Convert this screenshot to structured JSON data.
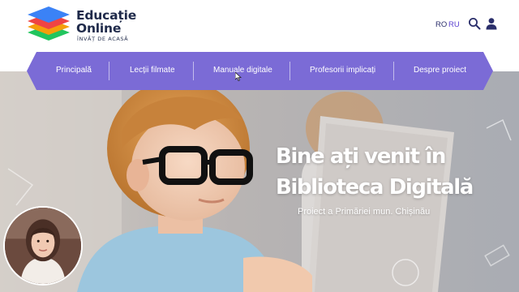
{
  "header": {
    "logo_title_line1": "Educație",
    "logo_title_line2": "Online",
    "logo_tagline": "ÎNVĂȚ DE ACASĂ",
    "languages": [
      "RO",
      "RU"
    ],
    "search_icon": "search-icon",
    "user_icon": "user-icon"
  },
  "nav": {
    "color": "#7b6bd6",
    "items": [
      "Principală",
      "Lecții filmate",
      "Manuale digitale",
      "Profesorii implicați",
      "Despre proiect"
    ]
  },
  "hero": {
    "title_line1": "Bine ați venit în",
    "title_line2": "Biblioteca Digitală",
    "subtitle": "Proiect a Primăriei mun. Chișinău"
  },
  "colors": {
    "logo_text": "#1f2a4a",
    "language_active": "#2b2f6b",
    "language_link": "#5a3fd0",
    "logo_layers": [
      "#3b82f6",
      "#ef4444",
      "#f59e0b",
      "#22c55e"
    ]
  }
}
